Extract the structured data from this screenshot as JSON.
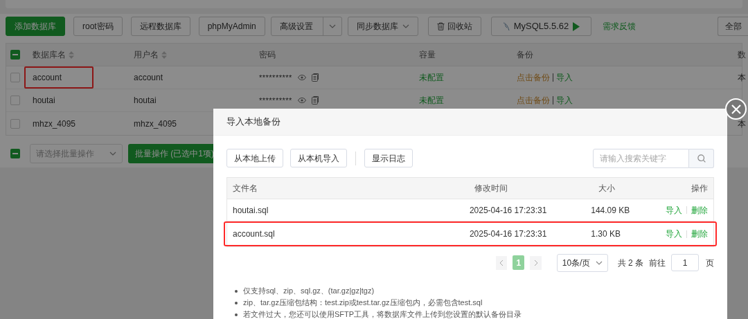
{
  "toolbar": {
    "buttons": [
      {
        "label": "添加数据库",
        "kind": "primary"
      },
      {
        "label": "root密码",
        "kind": "plain"
      },
      {
        "label": "远程数据库",
        "kind": "plain"
      },
      {
        "label": "phpMyAdmin",
        "kind": "plain"
      },
      {
        "label": "高级设置",
        "kind": "split"
      },
      {
        "label": "同步数据库",
        "kind": "dropdown"
      },
      {
        "label": "回收站",
        "kind": "trash"
      },
      {
        "label": "MySQL5.5.62",
        "kind": "version"
      }
    ],
    "feedback_link": "需求反馈",
    "right_button": "全部"
  },
  "table": {
    "all_checked": true,
    "columns": [
      {
        "label": "数据库名",
        "sortable": true
      },
      {
        "label": "用户名",
        "sortable": true
      },
      {
        "label": "密码",
        "sortable": false
      },
      {
        "label": "容量",
        "sortable": false
      },
      {
        "label": "备份",
        "sortable": false
      },
      {
        "label": "数"
      }
    ],
    "rows": [
      {
        "name": "account",
        "highlighted": true,
        "checked": false,
        "user": "account",
        "password": "**********",
        "capacity": "未配置",
        "backup": "点击备份",
        "import": "导入",
        "location": "本"
      },
      {
        "name": "houtai",
        "highlighted": false,
        "checked": false,
        "user": "houtai",
        "password": "**********",
        "capacity": "未配置",
        "backup": "点击备份",
        "import": "导入"
      },
      {
        "name": "mhzx_4095",
        "highlighted": false,
        "checked": false,
        "user": "mhzx_4095",
        "location": "本"
      }
    ]
  },
  "batch": {
    "all_checked": true,
    "placeholder": "请选择批量操作",
    "button": "批量操作 (已选中1项)"
  },
  "dialog": {
    "title": "导入本地备份",
    "buttons": [
      "从本地上传",
      "从本机导入",
      "显示日志"
    ],
    "search": {
      "placeholder": "请输入搜索关键字"
    },
    "columns": [
      "文件名",
      "修改时间",
      "大小",
      "操作"
    ],
    "files": [
      {
        "name": "houtai.sql",
        "time": "2025-04-16 17:23:31",
        "size": "144.09 KB",
        "actions": [
          "导入",
          "删除"
        ],
        "highlighted": false
      },
      {
        "name": "account.sql",
        "time": "2025-04-16 17:23:31",
        "size": "1.30 KB",
        "actions": [
          "导入",
          "删除"
        ],
        "highlighted": true
      }
    ],
    "pagination": {
      "pages": [
        {
          "label": "1",
          "selected": true
        }
      ],
      "page_size": "10条/页",
      "total": "共 2 条",
      "goto_label": "前往",
      "goto_value": "1",
      "page_unit": "页"
    },
    "notes": [
      "仅支持sql、zip、sql.gz、(tar.gz|gz|tgz)",
      "zip、tar.gz压缩包结构：test.zip或test.tar.gz压缩包内，必需包含test.sql",
      "若文件过大，您还可以使用SFTP工具，将数据库文件上传到您设置的默认备份目录"
    ]
  }
}
